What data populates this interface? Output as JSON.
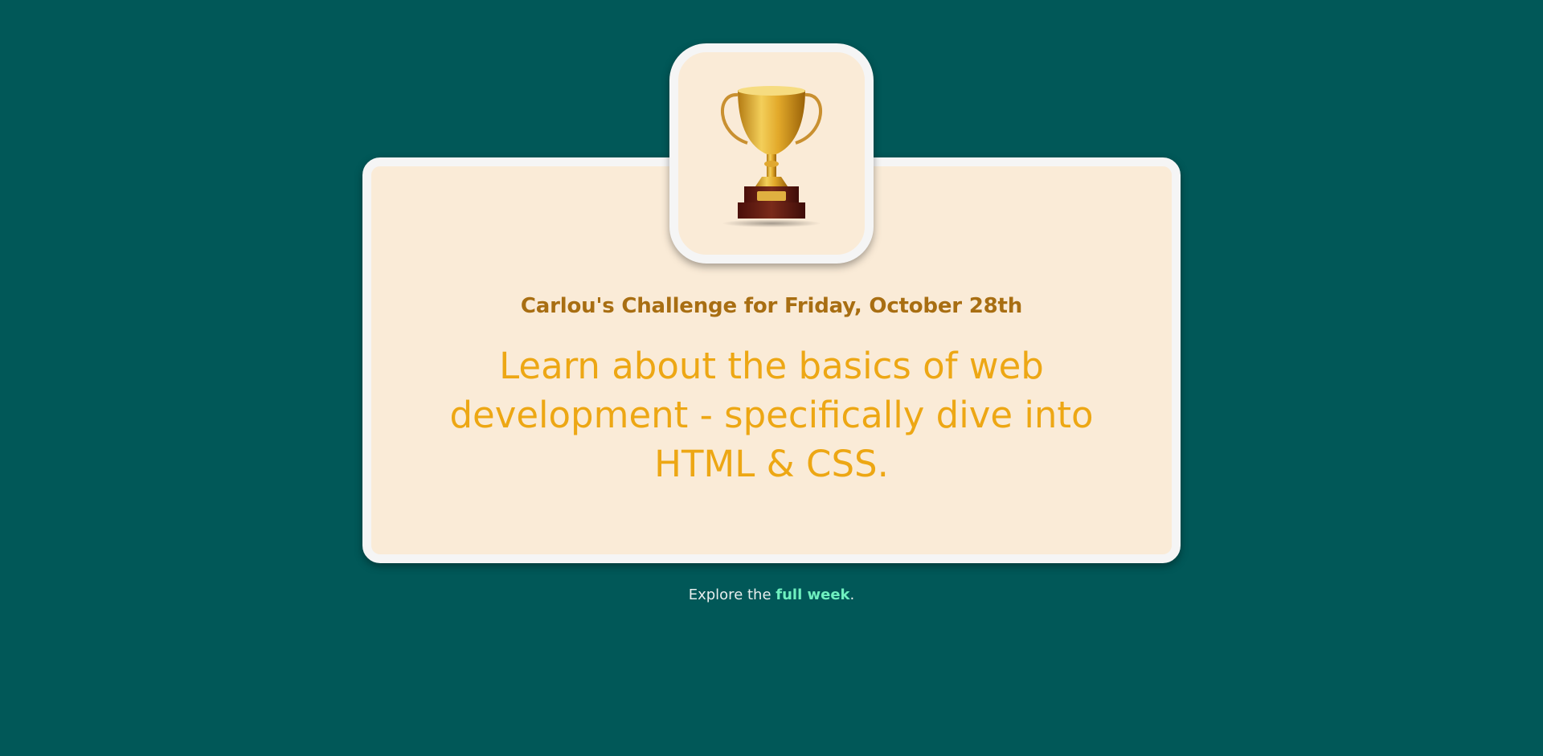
{
  "colors": {
    "background": "#015858",
    "card": "#faebd7",
    "card_border": "#f5f5f5",
    "kicker": "#a86e12",
    "headline": "#eda714",
    "footer_text": "#e8eeee",
    "link": "#6ff0bf"
  },
  "badge": {
    "icon": "trophy-icon"
  },
  "card": {
    "kicker": "Carlou's Challenge for Friday, October 28th",
    "headline": "Learn about the basics of web development - specifically dive into HTML & CSS."
  },
  "footer": {
    "prefix": "Explore the ",
    "link_label": "full week",
    "suffix": "."
  }
}
